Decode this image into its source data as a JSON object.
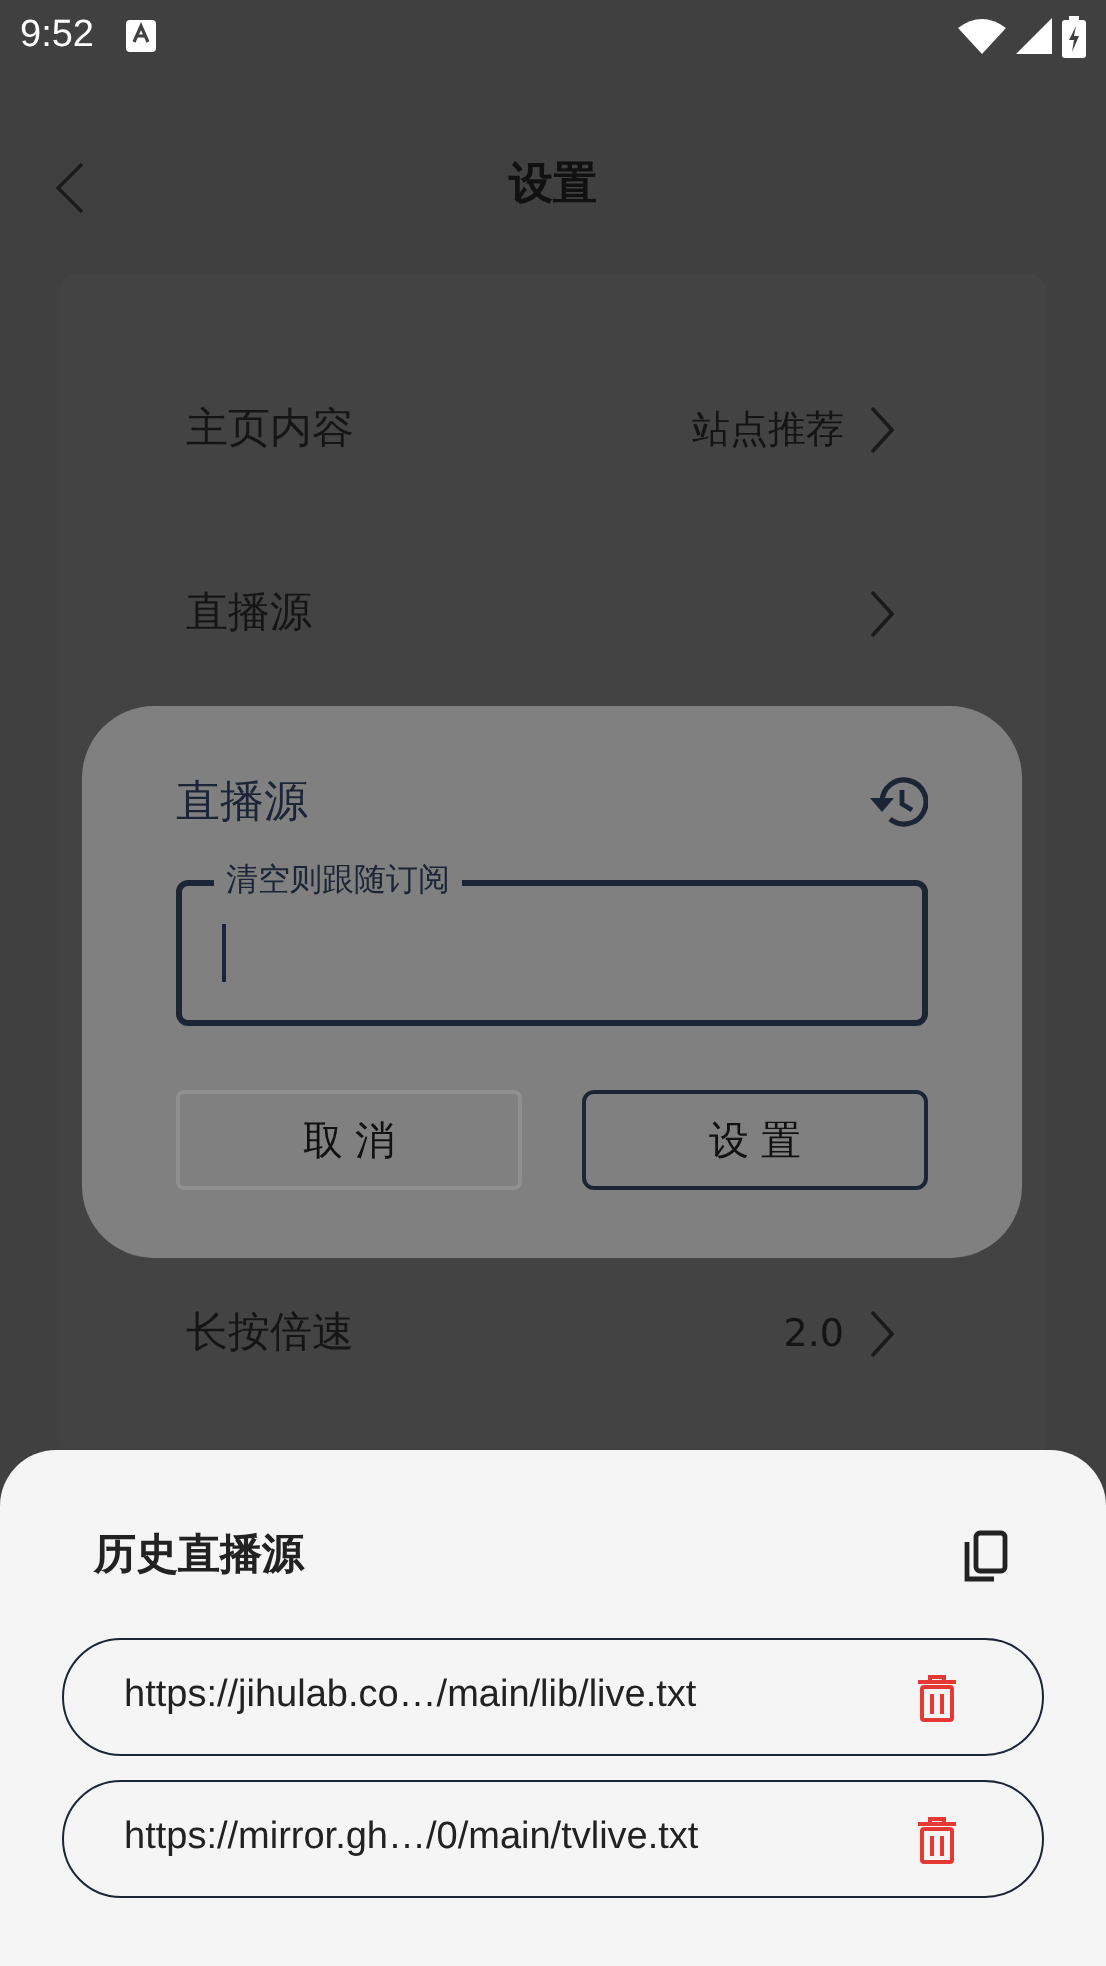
{
  "status_bar": {
    "time": "9:52"
  },
  "header": {
    "title": "设置"
  },
  "settings": [
    {
      "label": "主页内容",
      "value": "站点推荐"
    },
    {
      "label": "直播源"
    },
    {
      "label": "长按倍速",
      "value": "2.0"
    }
  ],
  "dialog": {
    "title": "直播源",
    "field": {
      "label": "清空则跟随订阅",
      "focused": true
    },
    "buttons": [
      {
        "label": "取 消",
        "kind": "secondary"
      },
      {
        "label": "设 置",
        "kind": "primary"
      }
    ]
  },
  "history_sheet": {
    "title": "历史直播源",
    "items": [
      {
        "url": "https://jihulab.co…/main/lib/live.txt"
      },
      {
        "url": "https://mirror.gh…/0/main/tvlive.txt"
      }
    ]
  }
}
